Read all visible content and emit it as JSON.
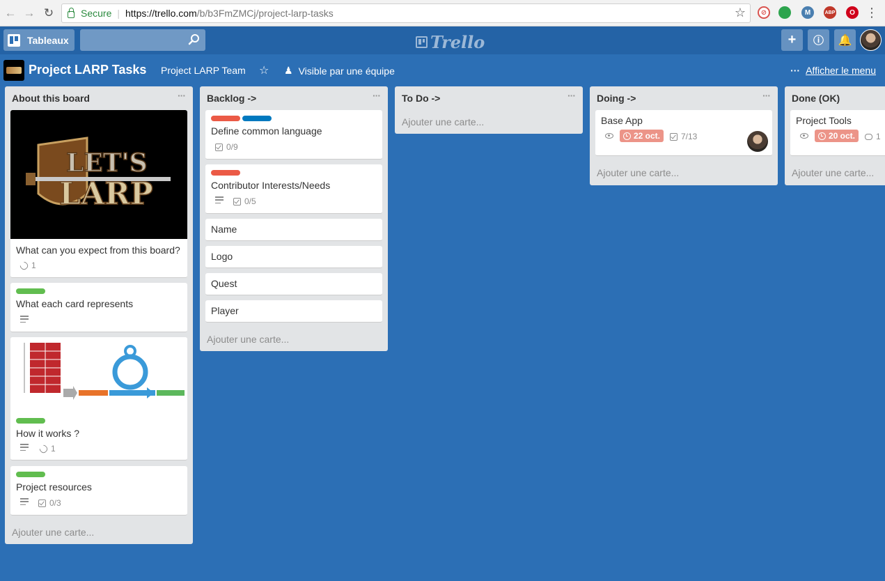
{
  "browser": {
    "secure_label": "Secure",
    "url_host": "https://trello.com",
    "url_path": "/b/b3FmZMCj/project-larp-tasks",
    "extensions": [
      {
        "name": "ext-blocked-icon",
        "badge": "1",
        "color": "#d9534f"
      },
      {
        "name": "ext-green-icon",
        "color": "#2da44e"
      },
      {
        "name": "ext-m-icon",
        "text": "M",
        "color": "#4a7fb0"
      },
      {
        "name": "ext-abp-icon",
        "text": "ABP",
        "color": "#c0392b"
      },
      {
        "name": "ext-opera-icon",
        "text": "O",
        "color": "#d0021b"
      }
    ]
  },
  "header": {
    "boards_label": "Tableaux",
    "search_value": "",
    "logo_text": "Trello"
  },
  "board": {
    "title": "Project LARP Tasks",
    "team": "Project LARP Team",
    "visibility": "Visible par une équipe",
    "show_menu": "Afficher le menu",
    "add_card_label": "Ajouter une carte..."
  },
  "lists": [
    {
      "title": "About this board",
      "cards": [
        {
          "title": "What can you expect from this board?",
          "cover": "larp",
          "attachments": "1"
        },
        {
          "title": "What each card represents",
          "labels": [
            "green"
          ],
          "description": true
        },
        {
          "title": "How it works ?",
          "cover": "scrum",
          "labels": [
            "green"
          ],
          "description": true,
          "attachments": "1"
        },
        {
          "title": "Project resources",
          "labels": [
            "green"
          ],
          "description": true,
          "checklist": "0/3"
        }
      ]
    },
    {
      "title": "Backlog ->",
      "cards": [
        {
          "title": "Define common language",
          "labels": [
            "red",
            "blue"
          ],
          "checklist": "0/9"
        },
        {
          "title": "Contributor Interests/Needs",
          "labels": [
            "red"
          ],
          "description": true,
          "checklist": "0/5"
        },
        {
          "title": "Name"
        },
        {
          "title": "Logo"
        },
        {
          "title": "Quest"
        },
        {
          "title": "Player"
        }
      ]
    },
    {
      "title": "To Do ->",
      "cards": []
    },
    {
      "title": "Doing ->",
      "cards": [
        {
          "title": "Base App",
          "watching": true,
          "due": "22 oct.",
          "checklist": "7/13",
          "member": true
        }
      ]
    },
    {
      "title": "Done (OK)",
      "cards": [
        {
          "title": "Project Tools",
          "watching": true,
          "due": "20 oct.",
          "comments": "1"
        }
      ]
    }
  ],
  "colors": {
    "board_bg": "#2c6fb5",
    "label_green": "#61bd4f",
    "label_red": "#eb5a46",
    "label_blue": "#0079bf",
    "due_bg": "#ec9488"
  }
}
